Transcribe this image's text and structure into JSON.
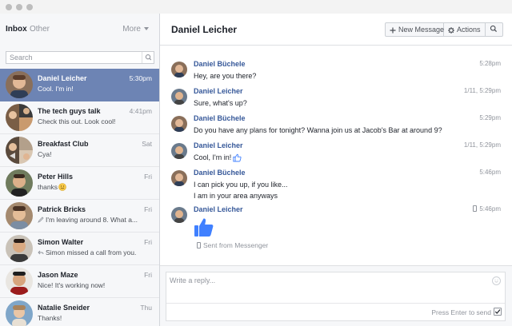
{
  "window": {
    "traffic_lights": [
      "close",
      "minimize",
      "zoom"
    ]
  },
  "sidebar": {
    "tabs": [
      {
        "label": "Inbox",
        "active": true
      },
      {
        "label": "Other",
        "active": false
      }
    ],
    "more_label": "More",
    "search": {
      "placeholder": "Search",
      "value": ""
    },
    "conversations": [
      {
        "name": "Daniel Leicher",
        "snippet": "Cool. I'm in!",
        "time": "5:30pm",
        "active": true
      },
      {
        "name": "The tech guys talk",
        "snippet": "Check this out. Look cool!",
        "time": "4:41pm",
        "active": false
      },
      {
        "name": "Breakfast Club",
        "snippet": "Cya!",
        "time": "Sat",
        "active": false
      },
      {
        "name": "Peter Hills",
        "snippet": "thanks",
        "time": "Fri",
        "active": false,
        "emoji": "smile-emoji"
      },
      {
        "name": "Patrick Bricks",
        "snippet": "I'm leaving around 8. What a...",
        "time": "Fri",
        "active": false,
        "icon": "pencil-icon"
      },
      {
        "name": "Simon Walter",
        "snippet": "Simon missed a call from you.",
        "time": "Fri",
        "active": false,
        "icon": "reply-icon"
      },
      {
        "name": "Jason Maze",
        "snippet": "Nice! It's working now!",
        "time": "Fri",
        "active": false
      },
      {
        "name": "Natalie Sneider",
        "snippet": "Thanks!",
        "time": "Thu",
        "active": false
      }
    ]
  },
  "main": {
    "title": "Daniel Leicher",
    "buttons": {
      "new_message": "New Message",
      "actions": "Actions",
      "search_icon": "search-icon"
    },
    "messages": [
      {
        "sender": "Daniel Büchele",
        "time": "5:28pm",
        "lines": [
          "Hey, are you there?"
        ]
      },
      {
        "sender": "Daniel Leicher",
        "time": "1/11, 5:29pm",
        "lines": [
          "Sure, what's up?"
        ]
      },
      {
        "sender": "Daniel Büchele",
        "time": "5:29pm",
        "lines": [
          "Do you have any plans for tonight? Wanna join us at Jacob's Bar at around 9?"
        ]
      },
      {
        "sender": "Daniel Leicher",
        "time": "1/11, 5:29pm",
        "lines": [
          "Cool, I'm in!"
        ],
        "like_icon": true
      },
      {
        "sender": "Daniel Büchele",
        "time": "5:46pm",
        "lines": [
          "I can pick you up, if you like...",
          "I am in your area anyways"
        ]
      },
      {
        "sender": "Daniel Leicher",
        "time": "5:46pm",
        "lines": [],
        "big_like": true,
        "footer": "Sent from Messenger",
        "time_icon": "phone-icon"
      }
    ],
    "composer": {
      "placeholder": "Write a reply...",
      "value": "",
      "send_hint": "Press Enter to send",
      "send_on_enter": true
    }
  },
  "colors": {
    "selected_row": "#6d84b4",
    "sender_link": "#365899",
    "like_blue": "#4080ff",
    "muted_text": "#90949c"
  }
}
